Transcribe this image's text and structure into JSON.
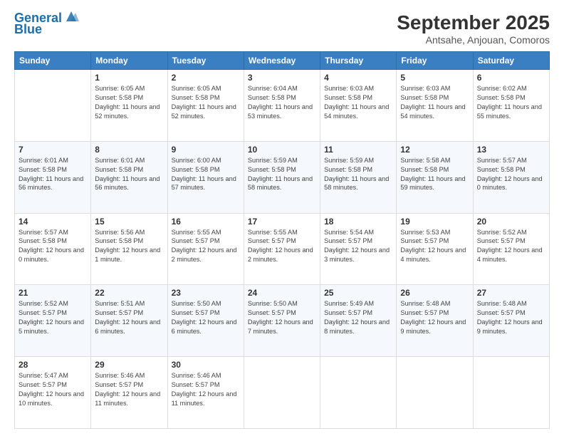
{
  "header": {
    "logo_line1": "General",
    "logo_line2": "Blue",
    "title": "September 2025",
    "subtitle": "Antsahe, Anjouan, Comoros"
  },
  "days_of_week": [
    "Sunday",
    "Monday",
    "Tuesday",
    "Wednesday",
    "Thursday",
    "Friday",
    "Saturday"
  ],
  "weeks": [
    [
      {
        "day": "",
        "sunrise": "",
        "sunset": "",
        "daylight": ""
      },
      {
        "day": "1",
        "sunrise": "Sunrise: 6:05 AM",
        "sunset": "Sunset: 5:58 PM",
        "daylight": "Daylight: 11 hours and 52 minutes."
      },
      {
        "day": "2",
        "sunrise": "Sunrise: 6:05 AM",
        "sunset": "Sunset: 5:58 PM",
        "daylight": "Daylight: 11 hours and 52 minutes."
      },
      {
        "day": "3",
        "sunrise": "Sunrise: 6:04 AM",
        "sunset": "Sunset: 5:58 PM",
        "daylight": "Daylight: 11 hours and 53 minutes."
      },
      {
        "day": "4",
        "sunrise": "Sunrise: 6:03 AM",
        "sunset": "Sunset: 5:58 PM",
        "daylight": "Daylight: 11 hours and 54 minutes."
      },
      {
        "day": "5",
        "sunrise": "Sunrise: 6:03 AM",
        "sunset": "Sunset: 5:58 PM",
        "daylight": "Daylight: 11 hours and 54 minutes."
      },
      {
        "day": "6",
        "sunrise": "Sunrise: 6:02 AM",
        "sunset": "Sunset: 5:58 PM",
        "daylight": "Daylight: 11 hours and 55 minutes."
      }
    ],
    [
      {
        "day": "7",
        "sunrise": "Sunrise: 6:01 AM",
        "sunset": "Sunset: 5:58 PM",
        "daylight": "Daylight: 11 hours and 56 minutes."
      },
      {
        "day": "8",
        "sunrise": "Sunrise: 6:01 AM",
        "sunset": "Sunset: 5:58 PM",
        "daylight": "Daylight: 11 hours and 56 minutes."
      },
      {
        "day": "9",
        "sunrise": "Sunrise: 6:00 AM",
        "sunset": "Sunset: 5:58 PM",
        "daylight": "Daylight: 11 hours and 57 minutes."
      },
      {
        "day": "10",
        "sunrise": "Sunrise: 5:59 AM",
        "sunset": "Sunset: 5:58 PM",
        "daylight": "Daylight: 11 hours and 58 minutes."
      },
      {
        "day": "11",
        "sunrise": "Sunrise: 5:59 AM",
        "sunset": "Sunset: 5:58 PM",
        "daylight": "Daylight: 11 hours and 58 minutes."
      },
      {
        "day": "12",
        "sunrise": "Sunrise: 5:58 AM",
        "sunset": "Sunset: 5:58 PM",
        "daylight": "Daylight: 11 hours and 59 minutes."
      },
      {
        "day": "13",
        "sunrise": "Sunrise: 5:57 AM",
        "sunset": "Sunset: 5:58 PM",
        "daylight": "Daylight: 12 hours and 0 minutes."
      }
    ],
    [
      {
        "day": "14",
        "sunrise": "Sunrise: 5:57 AM",
        "sunset": "Sunset: 5:58 PM",
        "daylight": "Daylight: 12 hours and 0 minutes."
      },
      {
        "day": "15",
        "sunrise": "Sunrise: 5:56 AM",
        "sunset": "Sunset: 5:58 PM",
        "daylight": "Daylight: 12 hours and 1 minute."
      },
      {
        "day": "16",
        "sunrise": "Sunrise: 5:55 AM",
        "sunset": "Sunset: 5:57 PM",
        "daylight": "Daylight: 12 hours and 2 minutes."
      },
      {
        "day": "17",
        "sunrise": "Sunrise: 5:55 AM",
        "sunset": "Sunset: 5:57 PM",
        "daylight": "Daylight: 12 hours and 2 minutes."
      },
      {
        "day": "18",
        "sunrise": "Sunrise: 5:54 AM",
        "sunset": "Sunset: 5:57 PM",
        "daylight": "Daylight: 12 hours and 3 minutes."
      },
      {
        "day": "19",
        "sunrise": "Sunrise: 5:53 AM",
        "sunset": "Sunset: 5:57 PM",
        "daylight": "Daylight: 12 hours and 4 minutes."
      },
      {
        "day": "20",
        "sunrise": "Sunrise: 5:52 AM",
        "sunset": "Sunset: 5:57 PM",
        "daylight": "Daylight: 12 hours and 4 minutes."
      }
    ],
    [
      {
        "day": "21",
        "sunrise": "Sunrise: 5:52 AM",
        "sunset": "Sunset: 5:57 PM",
        "daylight": "Daylight: 12 hours and 5 minutes."
      },
      {
        "day": "22",
        "sunrise": "Sunrise: 5:51 AM",
        "sunset": "Sunset: 5:57 PM",
        "daylight": "Daylight: 12 hours and 6 minutes."
      },
      {
        "day": "23",
        "sunrise": "Sunrise: 5:50 AM",
        "sunset": "Sunset: 5:57 PM",
        "daylight": "Daylight: 12 hours and 6 minutes."
      },
      {
        "day": "24",
        "sunrise": "Sunrise: 5:50 AM",
        "sunset": "Sunset: 5:57 PM",
        "daylight": "Daylight: 12 hours and 7 minutes."
      },
      {
        "day": "25",
        "sunrise": "Sunrise: 5:49 AM",
        "sunset": "Sunset: 5:57 PM",
        "daylight": "Daylight: 12 hours and 8 minutes."
      },
      {
        "day": "26",
        "sunrise": "Sunrise: 5:48 AM",
        "sunset": "Sunset: 5:57 PM",
        "daylight": "Daylight: 12 hours and 9 minutes."
      },
      {
        "day": "27",
        "sunrise": "Sunrise: 5:48 AM",
        "sunset": "Sunset: 5:57 PM",
        "daylight": "Daylight: 12 hours and 9 minutes."
      }
    ],
    [
      {
        "day": "28",
        "sunrise": "Sunrise: 5:47 AM",
        "sunset": "Sunset: 5:57 PM",
        "daylight": "Daylight: 12 hours and 10 minutes."
      },
      {
        "day": "29",
        "sunrise": "Sunrise: 5:46 AM",
        "sunset": "Sunset: 5:57 PM",
        "daylight": "Daylight: 12 hours and 11 minutes."
      },
      {
        "day": "30",
        "sunrise": "Sunrise: 5:46 AM",
        "sunset": "Sunset: 5:57 PM",
        "daylight": "Daylight: 12 hours and 11 minutes."
      },
      {
        "day": "",
        "sunrise": "",
        "sunset": "",
        "daylight": ""
      },
      {
        "day": "",
        "sunrise": "",
        "sunset": "",
        "daylight": ""
      },
      {
        "day": "",
        "sunrise": "",
        "sunset": "",
        "daylight": ""
      },
      {
        "day": "",
        "sunrise": "",
        "sunset": "",
        "daylight": ""
      }
    ]
  ]
}
